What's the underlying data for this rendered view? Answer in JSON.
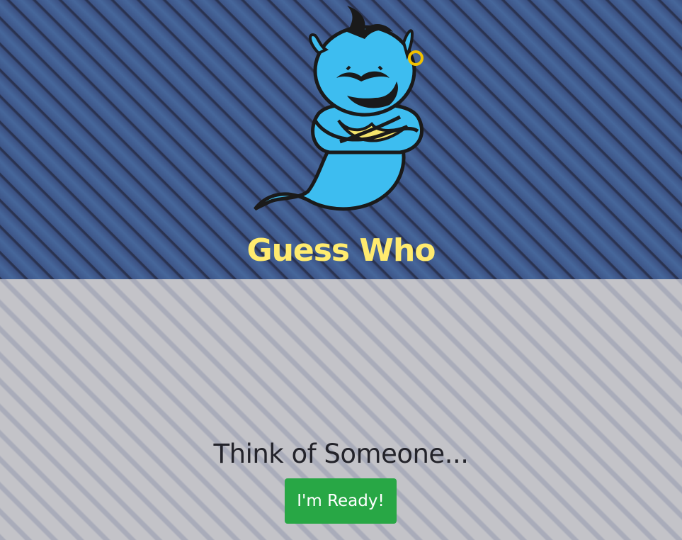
{
  "header": {
    "logo_icon": "genie-icon",
    "title": "Guess Who",
    "title_color": "#ffeb6e"
  },
  "main": {
    "prompt": "Think of Someone...",
    "ready_button_label": "I'm Ready!",
    "ready_button_color": "#28a745"
  }
}
